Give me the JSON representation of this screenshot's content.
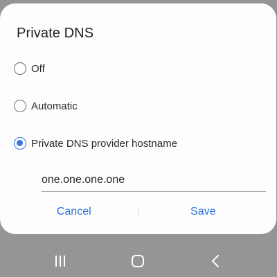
{
  "dialog": {
    "title": "Private DNS",
    "options": [
      {
        "label": "Off",
        "selected": false
      },
      {
        "label": "Automatic",
        "selected": false
      },
      {
        "label": "Private DNS provider hostname",
        "selected": true
      }
    ],
    "hostname_value": "one.one.one.one",
    "cancel_label": "Cancel",
    "save_label": "Save"
  },
  "navbar": {
    "icons": [
      "recents-icon",
      "home-icon",
      "back-icon"
    ]
  },
  "colors": {
    "accent": "#3677e0",
    "button_text": "#2d72d9",
    "scrim": "#959595",
    "dialog_bg": "#fdfdfd"
  }
}
